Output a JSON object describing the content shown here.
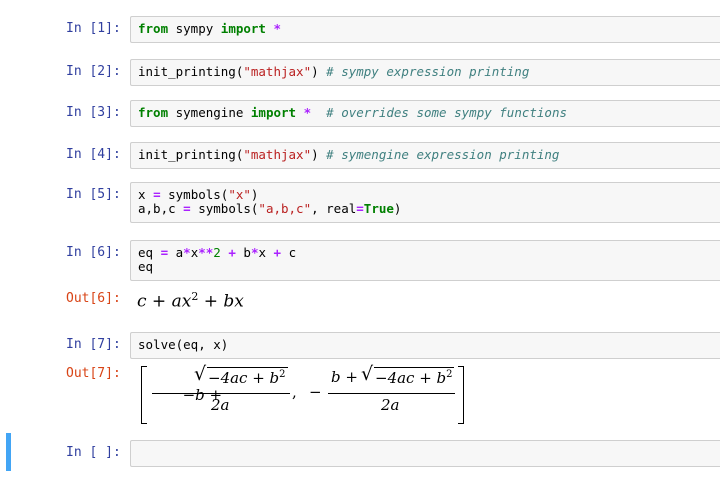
{
  "cells": [
    {
      "prompt": "In [1]:"
    },
    {
      "prompt": "In [2]:"
    },
    {
      "prompt": "In [3]:"
    },
    {
      "prompt": "In [4]:"
    },
    {
      "prompt": "In [5]:"
    },
    {
      "prompt": "In [6]:",
      "out_prompt": "Out[6]:"
    },
    {
      "prompt": "In [7]:",
      "out_prompt": "Out[7]:"
    },
    {
      "prompt": "In [ ]:"
    }
  ],
  "code": {
    "c1_from": "from",
    "c1_mod": " sympy ",
    "c1_import": "import",
    "c1_star": " *",
    "c2_call": "init_printing(",
    "c2_str": "\"mathjax\"",
    "c2_close": ") ",
    "c2_cmt": "# sympy expression printing",
    "c3_from": "from",
    "c3_mod": " symengine ",
    "c3_import": "import",
    "c3_star": " *",
    "c3_cmt": "  # overrides some sympy functions",
    "c4_call": "init_printing(",
    "c4_str": "\"mathjax\"",
    "c4_close": ") ",
    "c4_cmt": "# symengine expression printing",
    "c5_l1a": "x ",
    "c5_l1eq": "=",
    "c5_l1b": " symbols(",
    "c5_l1str": "\"x\"",
    "c5_l1c": ")",
    "c5_l2a": "a,b,c ",
    "c5_l2eq": "=",
    "c5_l2b": " symbols(",
    "c5_l2str": "\"a,b,c\"",
    "c5_l2c": ", real",
    "c5_l2eq2": "=",
    "c5_l2true": "True",
    "c5_l2d": ")",
    "c6_l1a": "eq ",
    "c6_eq": "=",
    "c6_a": " a",
    "c6_m1": "*",
    "c6_x1": "x",
    "c6_pow": "**",
    "c6_2": "2",
    "c6_plus1": " + ",
    "c6_b": "b",
    "c6_m2": "*",
    "c6_x2": "x",
    "c6_plus2": " + ",
    "c6_c": "c",
    "c6_l2": "eq",
    "c7": "solve(eq, x)"
  },
  "outputs": {
    "out6": {
      "c": "c",
      "plus1": " + ",
      "ax": "ax",
      "sup2": "2",
      "plus2": " + ",
      "bx": "bx"
    },
    "out7": {
      "num1_lead": "−b + ",
      "radicand": "−4ac + b",
      "sup2": "2",
      "den": "2a",
      "comma": ",",
      "minus": "−",
      "num2_lead": "b + "
    }
  }
}
